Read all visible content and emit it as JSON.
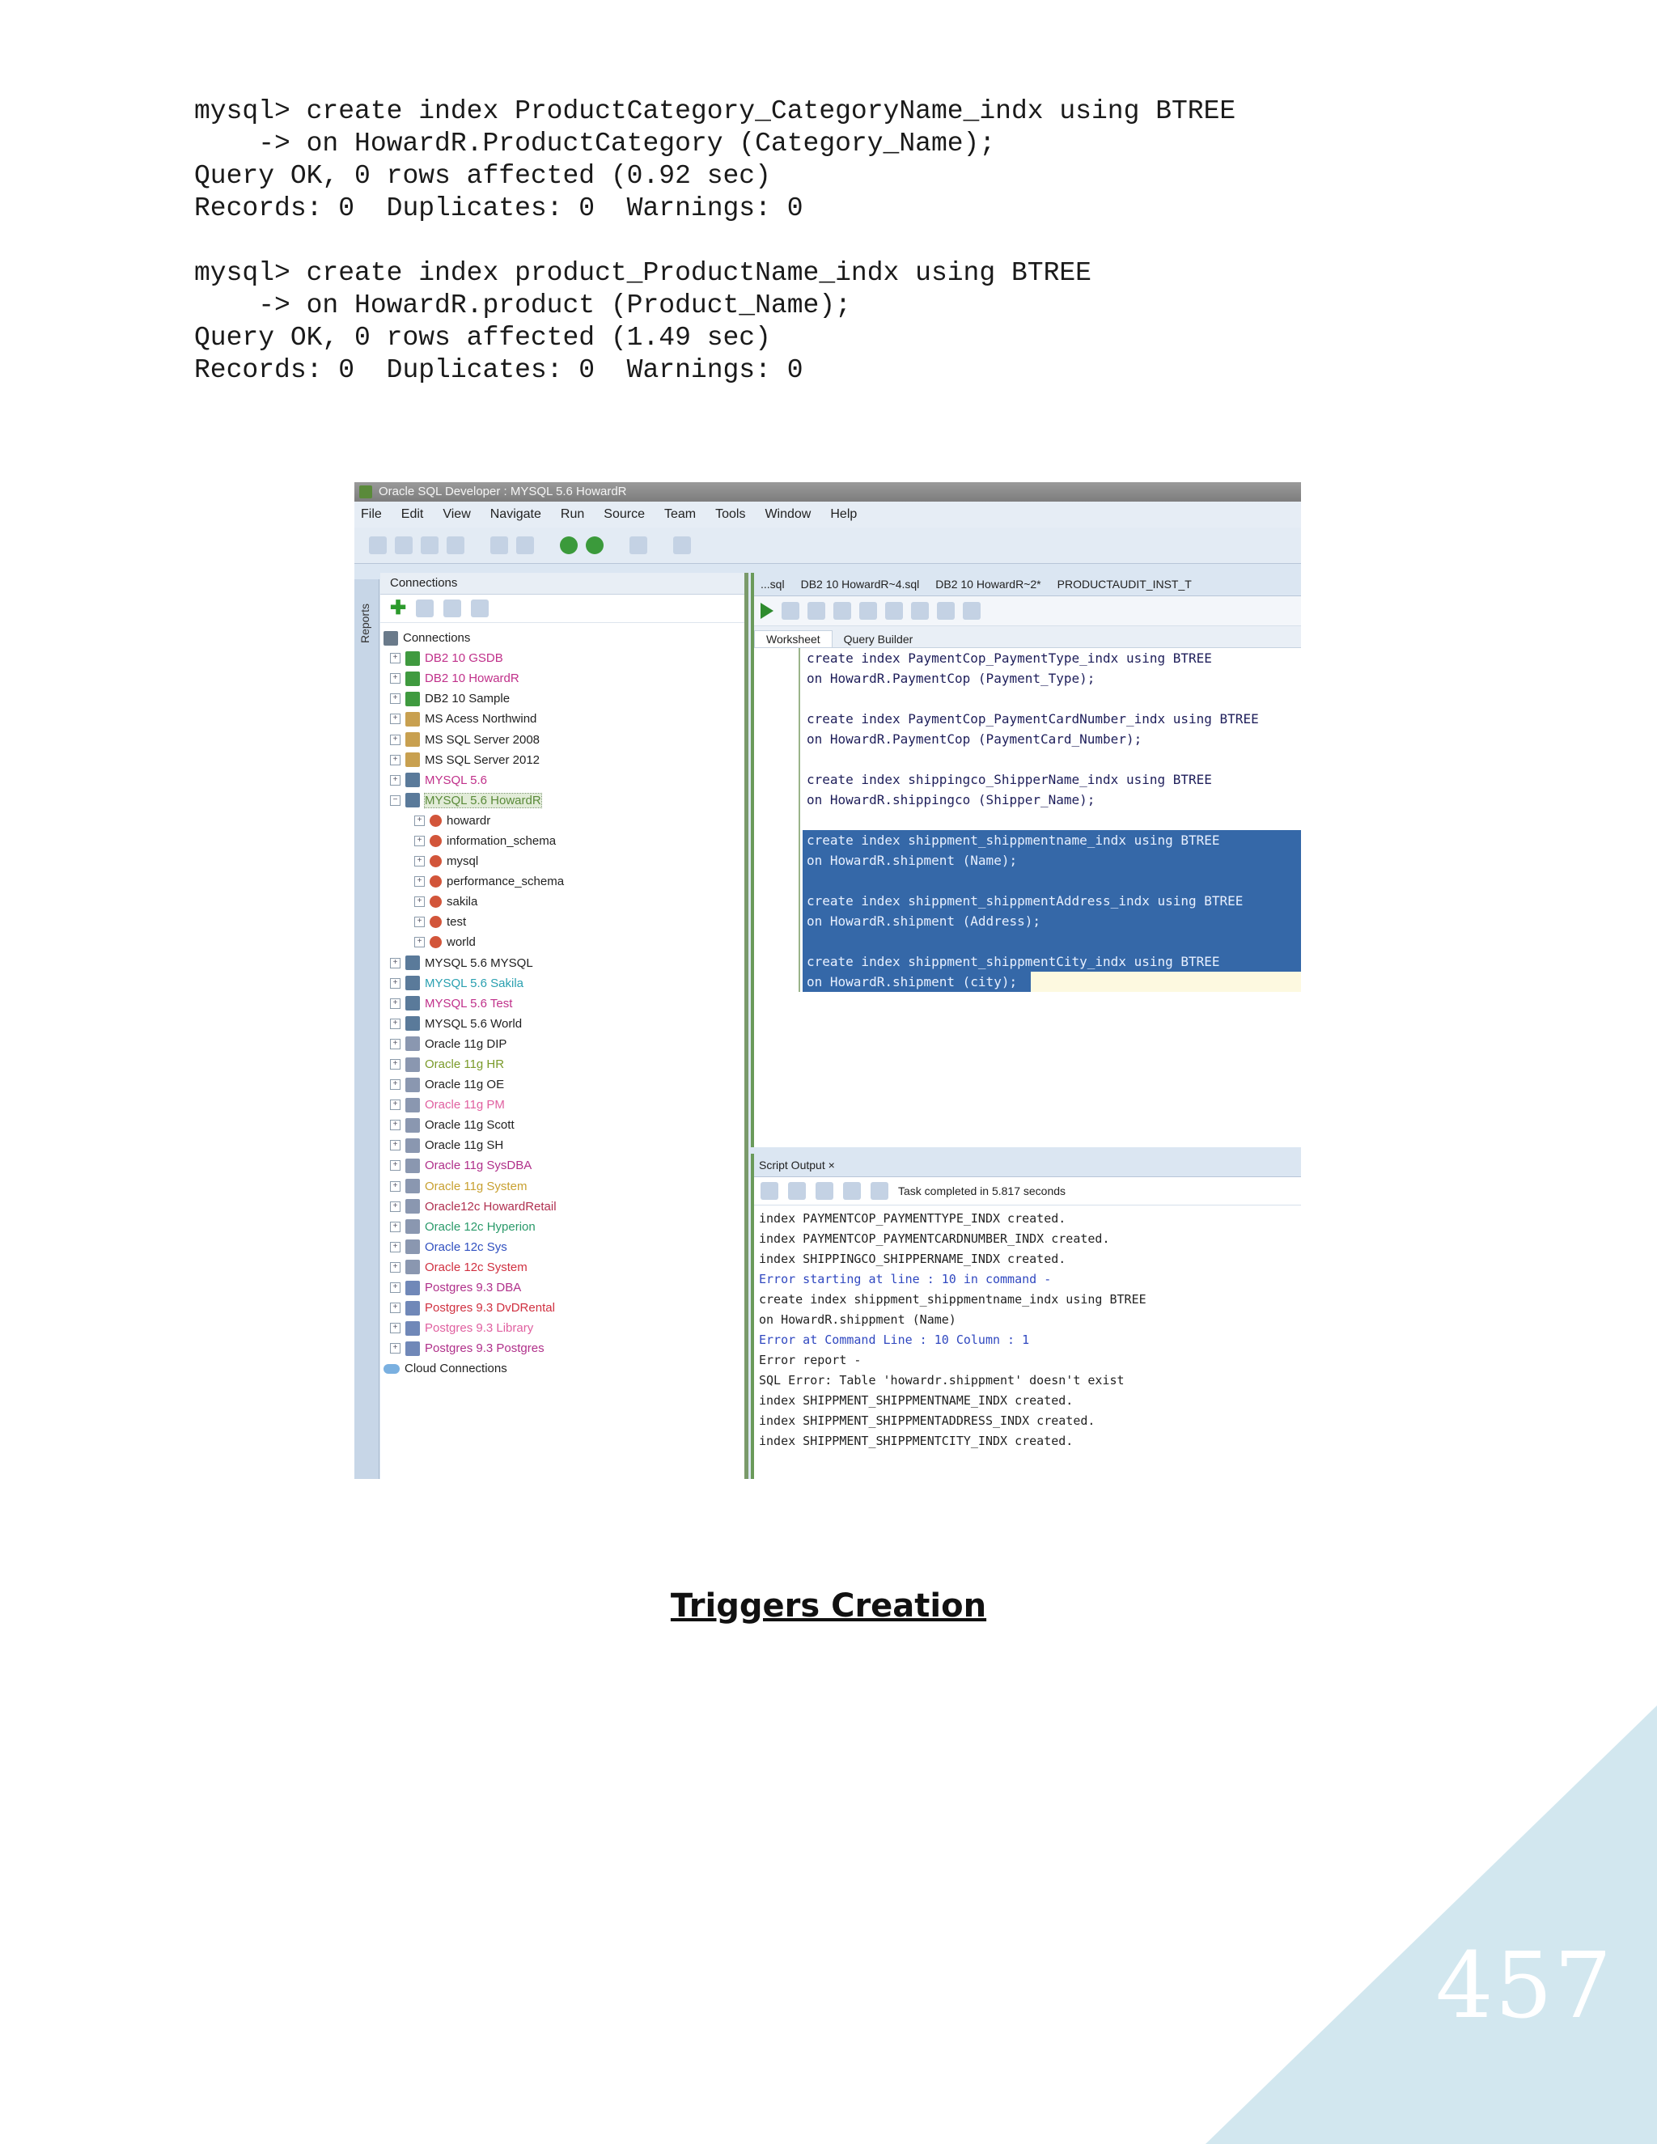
{
  "console": {
    "lines": [
      "mysql> create index ProductCategory_CategoryName_indx using BTREE",
      "    -> on HowardR.ProductCategory (Category_Name);",
      "Query OK, 0 rows affected (0.92 sec)",
      "Records: 0  Duplicates: 0  Warnings: 0",
      "",
      "mysql> create index product_ProductName_indx using BTREE",
      "    -> on HowardR.product (Product_Name);",
      "Query OK, 0 rows affected (1.49 sec)",
      "Records: 0  Duplicates: 0  Warnings: 0"
    ]
  },
  "ide": {
    "title": "Oracle SQL Developer : MYSQL 5.6 HowardR",
    "menu": [
      "File",
      "Edit",
      "View",
      "Navigate",
      "Run",
      "Source",
      "Team",
      "Tools",
      "Window",
      "Help"
    ],
    "side_label": "Reports",
    "connections": {
      "title": "Connections",
      "items": [
        {
          "label": "Connections",
          "level": 0,
          "icon": "root",
          "color": "#222222"
        },
        {
          "label": "DB2 10 GSDB",
          "level": 1,
          "icon": "db2",
          "color": "#c0308a"
        },
        {
          "label": "DB2 10 HowardR",
          "level": 1,
          "icon": "db2",
          "color": "#c0308a"
        },
        {
          "label": "DB2 10 Sample",
          "level": 1,
          "icon": "db2",
          "color": "#222222"
        },
        {
          "label": "MS Acess Northwind",
          "level": 1,
          "icon": "ms",
          "color": "#222222"
        },
        {
          "label": "MS SQL Server 2008",
          "level": 1,
          "icon": "ms",
          "color": "#222222"
        },
        {
          "label": "MS SQL Server 2012",
          "level": 1,
          "icon": "ms",
          "color": "#222222"
        },
        {
          "label": "MYSQL 5.6",
          "level": 1,
          "icon": "my",
          "color": "#c0308a"
        },
        {
          "label": "MYSQL 5.6 HowardR",
          "level": 1,
          "icon": "my",
          "color": "#5a8a3a"
        },
        {
          "label": "howardr",
          "level": 2,
          "icon": "schema",
          "color": "#222222"
        },
        {
          "label": "information_schema",
          "level": 2,
          "icon": "schema",
          "color": "#222222"
        },
        {
          "label": "mysql",
          "level": 2,
          "icon": "schema",
          "color": "#222222"
        },
        {
          "label": "performance_schema",
          "level": 2,
          "icon": "schema",
          "color": "#222222"
        },
        {
          "label": "sakila",
          "level": 2,
          "icon": "schema",
          "color": "#222222"
        },
        {
          "label": "test",
          "level": 2,
          "icon": "schema",
          "color": "#222222"
        },
        {
          "label": "world",
          "level": 2,
          "icon": "schema",
          "color": "#222222"
        },
        {
          "label": "MYSQL 5.6 MYSQL",
          "level": 1,
          "icon": "my",
          "color": "#222222"
        },
        {
          "label": "MYSQL 5.6 Sakila",
          "level": 1,
          "icon": "my",
          "color": "#2aa0b0"
        },
        {
          "label": "MYSQL 5.6 Test",
          "level": 1,
          "icon": "my",
          "color": "#c0308a"
        },
        {
          "label": "MYSQL 5.6 World",
          "level": 1,
          "icon": "my",
          "color": "#222222"
        },
        {
          "label": "Oracle 11g DIP",
          "level": 1,
          "icon": "ora",
          "color": "#222222"
        },
        {
          "label": "Oracle 11g HR",
          "level": 1,
          "icon": "ora",
          "color": "#7a9a2a"
        },
        {
          "label": "Oracle 11g OE",
          "level": 1,
          "icon": "ora",
          "color": "#222222"
        },
        {
          "label": "Oracle 11g PM",
          "level": 1,
          "icon": "ora",
          "color": "#e060a0"
        },
        {
          "label": "Oracle 11g Scott",
          "level": 1,
          "icon": "ora",
          "color": "#222222"
        },
        {
          "label": "Oracle 11g SH",
          "level": 1,
          "icon": "ora",
          "color": "#222222"
        },
        {
          "label": "Oracle 11g SysDBA",
          "level": 1,
          "icon": "ora",
          "color": "#b0308a"
        },
        {
          "label": "Oracle 11g System",
          "level": 1,
          "icon": "ora",
          "color": "#c8a030"
        },
        {
          "label": "Oracle12c HowardRetail",
          "level": 1,
          "icon": "ora",
          "color": "#b03050"
        },
        {
          "label": "Oracle 12c Hyperion",
          "level": 1,
          "icon": "ora",
          "color": "#2a9a6a"
        },
        {
          "label": "Oracle 12c Sys",
          "level": 1,
          "icon": "ora",
          "color": "#3050c0"
        },
        {
          "label": "Oracle 12c System",
          "level": 1,
          "icon": "ora",
          "color": "#d03040"
        },
        {
          "label": "Postgres 9.3 DBA",
          "level": 1,
          "icon": "pg",
          "color": "#b0308a"
        },
        {
          "label": "Postgres 9.3 DvDRental",
          "level": 1,
          "icon": "pg",
          "color": "#d03040"
        },
        {
          "label": "Postgres 9.3 Library",
          "level": 1,
          "icon": "pg",
          "color": "#e060a0"
        },
        {
          "label": "Postgres 9.3 Postgres",
          "level": 1,
          "icon": "pg",
          "color": "#b0308a"
        },
        {
          "label": "Cloud Connections",
          "level": 0,
          "icon": "cloud",
          "color": "#222222"
        }
      ]
    },
    "editor_tabs": [
      "...sql",
      "DB2 10 HowardR~4.sql",
      "DB2 10 HowardR~2*",
      "PRODUCTAUDIT_INST_T"
    ],
    "subtabs": [
      "Worksheet",
      "Query Builder"
    ],
    "code_lines": [
      {
        "text": "create index PaymentCop_PaymentType_indx using BTREE",
        "sel": false
      },
      {
        "text": "on HowardR.PaymentCop (Payment_Type);",
        "sel": false
      },
      {
        "text": "",
        "sel": false
      },
      {
        "text": "create index PaymentCop_PaymentCardNumber_indx using BTREE",
        "sel": false
      },
      {
        "text": "on HowardR.PaymentCop (PaymentCard_Number);",
        "sel": false
      },
      {
        "text": "",
        "sel": false
      },
      {
        "text": "create index shippingco_ShipperName_indx using BTREE",
        "sel": false
      },
      {
        "text": "on HowardR.shippingco (Shipper_Name);",
        "sel": false
      },
      {
        "text": "",
        "sel": false
      },
      {
        "text": "create index shippment_shippmentname_indx using BTREE",
        "sel": true
      },
      {
        "text": "on HowardR.shipment (Name);",
        "sel": true
      },
      {
        "text": "",
        "sel": true
      },
      {
        "text": "create index shippment_shippmentAddress_indx using BTREE",
        "sel": true
      },
      {
        "text": "on HowardR.shipment (Address);",
        "sel": true
      },
      {
        "text": "",
        "sel": true
      },
      {
        "text": "create index shippment_shippmentCity_indx using BTREE",
        "sel": true
      },
      {
        "text": "on HowardR.shipment (city);",
        "sel": "last"
      }
    ],
    "output": {
      "tab": "Script Output",
      "status": "Task completed in 5.817 seconds",
      "lines": [
        {
          "text": "index PAYMENTCOP_PAYMENTTYPE_INDX created.",
          "err": false
        },
        {
          "text": "index PAYMENTCOP_PAYMENTCARDNUMBER_INDX created.",
          "err": false
        },
        {
          "text": "index SHIPPINGCO_SHIPPERNAME_INDX created.",
          "err": false
        },
        {
          "text": "Error starting at line : 10 in command -",
          "err": true
        },
        {
          "text": "create index shippment_shippmentname_indx using BTREE",
          "err": false
        },
        {
          "text": "on HowardR.shippment (Name)",
          "err": false
        },
        {
          "text": "Error at Command Line : 10 Column : 1",
          "err": true
        },
        {
          "text": "Error report -",
          "err": false
        },
        {
          "text": "SQL Error: Table 'howardr.shippment' doesn't exist",
          "err": false
        },
        {
          "text": "index SHIPPMENT_SHIPPMENTNAME_INDX created.",
          "err": false
        },
        {
          "text": "index SHIPPMENT_SHIPPMENTADDRESS_INDX created.",
          "err": false
        },
        {
          "text": "index SHIPPMENT_SHIPPMENTCITY_INDX created.",
          "err": false
        }
      ]
    }
  },
  "heading": "Triggers Creation",
  "page_number": "457",
  "colors": {
    "corner_triangle": "#d2e7ef",
    "selection": "#3568a8"
  }
}
